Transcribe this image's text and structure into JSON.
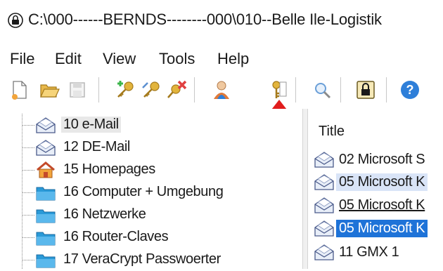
{
  "window": {
    "title": "C:\\000------BERNDS--------000\\010--Belle Ile-Logistik"
  },
  "menu": [
    "File",
    "Edit",
    "View",
    "Tools",
    "Help"
  ],
  "toolbar": {
    "buttons": [
      {
        "name": "new-file-icon",
        "color": "#f2a43a"
      },
      {
        "name": "open-folder-icon",
        "color": "#e8b84a"
      },
      {
        "name": "save-icon",
        "color": "#b8b8b8"
      },
      {
        "name": "add-key-icon",
        "color": "#3bb54a"
      },
      {
        "name": "edit-key-icon",
        "color": "#e2b43c"
      },
      {
        "name": "delete-key-icon",
        "color": "#e04040"
      },
      {
        "name": "user-icon",
        "color": "#e07a3a"
      },
      {
        "name": "key-icon",
        "color": "#e2b43c"
      },
      {
        "name": "search-icon",
        "color": "#6a9fd8"
      },
      {
        "name": "lock-icon",
        "color": "#8a7a40"
      },
      {
        "name": "help-icon",
        "color": "#2e7fd9"
      }
    ],
    "annotation_color": "#e11d1d"
  },
  "tree": {
    "items": [
      {
        "label": "10 e-Mail",
        "icon": "envelope-icon",
        "selected": true
      },
      {
        "label": "12 DE-Mail",
        "icon": "envelope-icon",
        "selected": false
      },
      {
        "label": "15 Homepages",
        "icon": "home-icon",
        "selected": false
      },
      {
        "label": "16 Computer + Umgebung",
        "icon": "folder-icon",
        "selected": false
      },
      {
        "label": "16 Netzwerke",
        "icon": "folder-icon",
        "selected": false
      },
      {
        "label": "16 Router-Claves",
        "icon": "folder-icon",
        "selected": false
      },
      {
        "label": "17 VeraCrypt Passwoerter",
        "icon": "folder-icon",
        "selected": false
      }
    ]
  },
  "list": {
    "column_title": "Title",
    "items": [
      {
        "label": "02 Microsoft S",
        "state": "normal"
      },
      {
        "label": "05 Microsoft K",
        "state": "highlight"
      },
      {
        "label": "05 Microsoft K",
        "state": "underline"
      },
      {
        "label": "05 Microsoft K",
        "state": "selected"
      },
      {
        "label": "11 GMX 1",
        "state": "normal"
      }
    ]
  }
}
